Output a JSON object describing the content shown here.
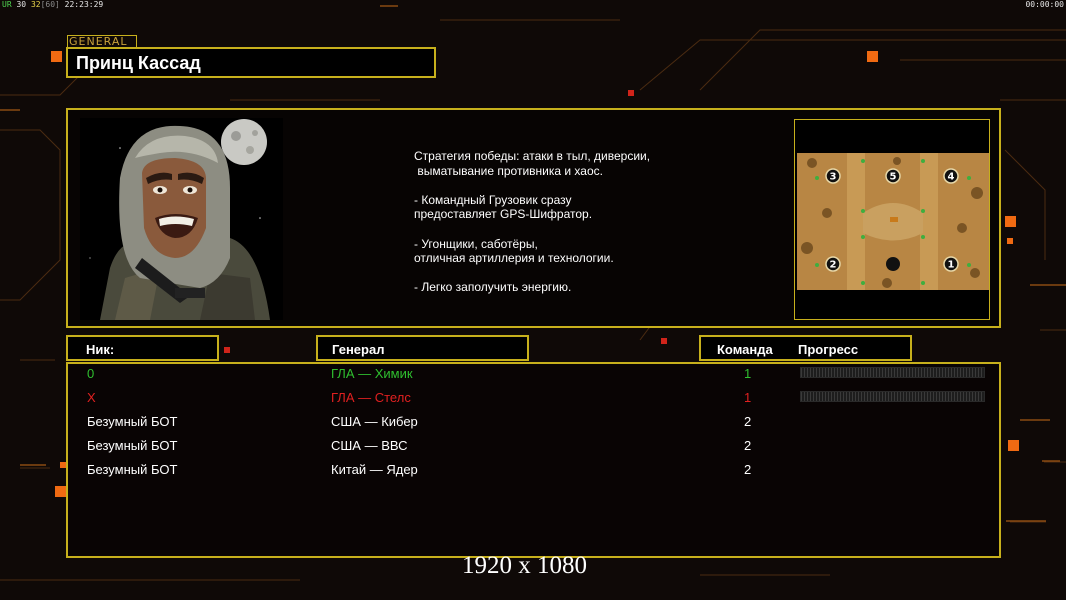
{
  "hud": {
    "left_tag": "UR",
    "left_fps": "30",
    "left_val": "32",
    "left_limit": "[60]",
    "left_time": "22:23:29",
    "right_time": "00:00:00"
  },
  "general": {
    "tag": "GENERAL",
    "name": "Принц Кассад"
  },
  "strategy": {
    "lines": [
      "Стратегия победы: атаки в тыл, диверсии,\n выматывание противника и хаос.",
      "- Командный Грузовик сразу\nпредоставляет GPS-Шифратор.",
      "- Угонщики, саботёры,\nотличная артиллерия и технологии.",
      "- Легко заполучить энергию."
    ]
  },
  "map": {
    "start_positions": [
      "3",
      "5",
      "4",
      "2",
      "1"
    ]
  },
  "columns": {
    "nick": "Ник:",
    "general": "Генерал",
    "team": "Команда",
    "progress": "Прогресс"
  },
  "players": [
    {
      "nick": "0",
      "general": "ГЛА — Химик",
      "team": "1",
      "color": "#2fbf2f",
      "progress": 0
    },
    {
      "nick": "X",
      "general": "ГЛА — Стелс",
      "team": "1",
      "color": "#e02020",
      "progress": 0
    },
    {
      "nick": "Безумный БОТ",
      "general": "США — Кибер",
      "team": "2",
      "color": "#ffffff"
    },
    {
      "nick": "Безумный БОТ",
      "general": "США — ВВС",
      "team": "2",
      "color": "#ffffff"
    },
    {
      "nick": "Безумный БОТ",
      "general": "Китай — Ядер",
      "team": "2",
      "color": "#ffffff"
    }
  ],
  "resolution": "1920 x 1080",
  "colors": {
    "frame": "#c7b01c",
    "accent": "#f47a1a"
  }
}
